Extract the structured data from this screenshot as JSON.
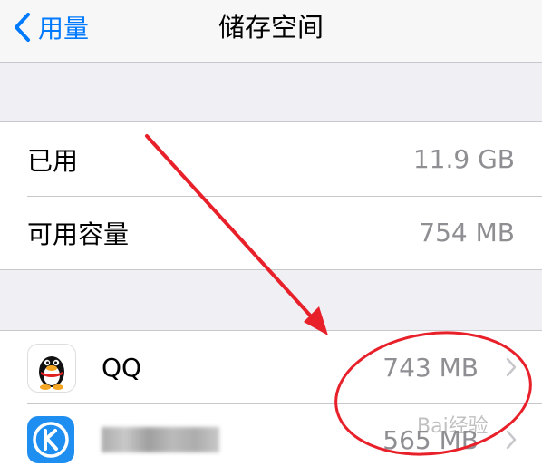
{
  "nav": {
    "back_label": "用量",
    "title": "储存空间"
  },
  "summary": [
    {
      "label": "已用",
      "value": "11.9 GB"
    },
    {
      "label": "可用容量",
      "value": "754 MB"
    }
  ],
  "apps": [
    {
      "name": "QQ",
      "size": "743 MB"
    },
    {
      "name": "",
      "size": "565 MB"
    }
  ],
  "watermark": "Bai经验",
  "colors": {
    "accent": "#007aff",
    "annotation": "#e8202a"
  }
}
